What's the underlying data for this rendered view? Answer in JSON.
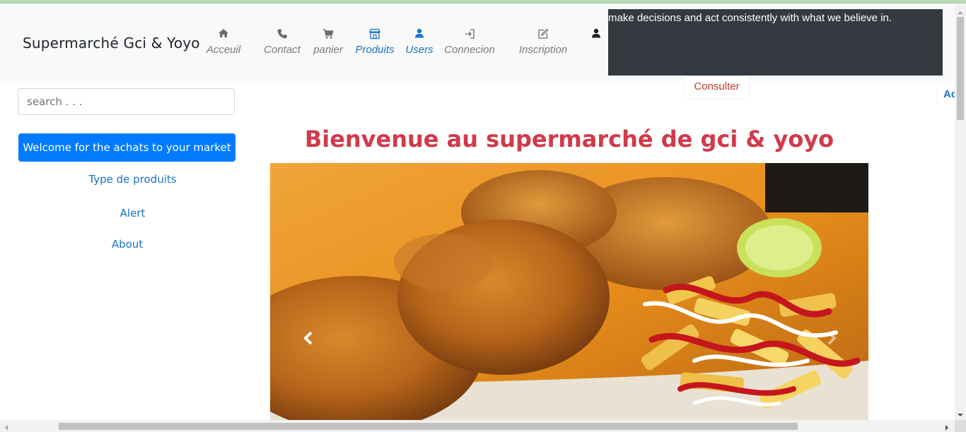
{
  "navbar": {
    "brand": "Supermarché Gci & Yoyo",
    "items": [
      {
        "label": "Acceuil",
        "icon": "home-icon"
      },
      {
        "label": "Contact",
        "icon": "phone-icon"
      },
      {
        "label": "panier",
        "icon": "cart-icon"
      },
      {
        "label": "Produits",
        "icon": "store-icon",
        "active": true
      },
      {
        "label": "Users",
        "icon": "user-icon",
        "active": true
      },
      {
        "label": "Connecion",
        "icon": "sign-in-icon"
      },
      {
        "label": "Inscription",
        "icon": "edit-icon"
      }
    ],
    "user_icon": "user-icon"
  },
  "tooltip": {
    "text": "make decisions and act consistently with what we believe in."
  },
  "consulter_label": "Consulter",
  "edge_text": "Ac",
  "sidebar": {
    "search_placeholder": "search . . .",
    "welcome_button": "Welcome for the achats to your market",
    "links": [
      "Type de produits",
      "Alert",
      "About"
    ]
  },
  "main": {
    "title": "Bienvenue au supermarché de gci & yoyo",
    "carousel": {
      "image": "fried-chicken-and-fries-photo",
      "prev_icon": "chevron-left-icon",
      "next_icon": "chevron-right-icon"
    }
  },
  "colors": {
    "primary": "#007bff",
    "link": "#1a73c8",
    "title": "#d2394a",
    "tooltip_bg": "#343a40",
    "navbar_bg": "#f8f9fa"
  }
}
